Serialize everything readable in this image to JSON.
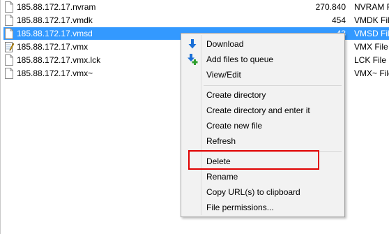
{
  "files": [
    {
      "name": "185.88.172.17.nvram",
      "size": "270.840",
      "type": "NVRAM F",
      "icon": "file-icon",
      "selected": false
    },
    {
      "name": "185.88.172.17.vmdk",
      "size": "454",
      "type": "VMDK File",
      "icon": "file-icon",
      "selected": false
    },
    {
      "name": "185.88.172.17.vmsd",
      "size": "43",
      "type": "VMSD File",
      "icon": "file-icon",
      "selected": true
    },
    {
      "name": "185.88.172.17.vmx",
      "size": "",
      "type": "VMX File",
      "icon": "notepad-file-icon",
      "selected": false
    },
    {
      "name": "185.88.172.17.vmx.lck",
      "size": "",
      "type": "LCK File",
      "icon": "file-icon",
      "selected": false
    },
    {
      "name": "185.88.172.17.vmx~",
      "size": "",
      "type": "VMX~ File",
      "icon": "file-icon",
      "selected": false
    }
  ],
  "context_menu": {
    "download": "Download",
    "add_to_queue": "Add files to queue",
    "view_edit": "View/Edit",
    "create_directory": "Create directory",
    "create_directory_enter": "Create directory and enter it",
    "create_new_file": "Create new file",
    "refresh": "Refresh",
    "delete": "Delete",
    "rename": "Rename",
    "copy_url": "Copy URL(s) to clipboard",
    "file_permissions": "File permissions..."
  },
  "colors": {
    "selection": "#3399ff",
    "highlight_outline": "#e00000",
    "download_arrow": "#1a6fd6",
    "queue_plus": "#2e9e2e"
  }
}
